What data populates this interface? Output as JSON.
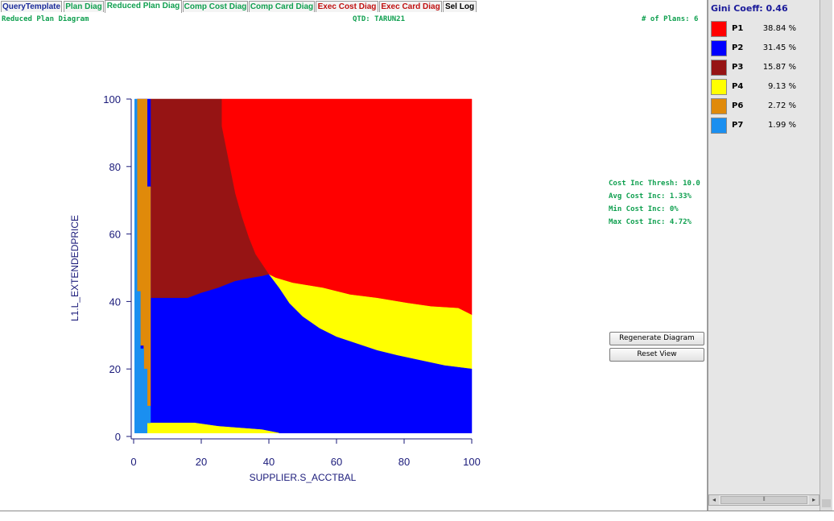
{
  "tabs": [
    {
      "label": "QueryTemplate",
      "color": "#1a2b9a",
      "active": false
    },
    {
      "label": "Plan Diag",
      "color": "#10a050",
      "active": false
    },
    {
      "label": "Reduced Plan Diag",
      "color": "#10a050",
      "active": true
    },
    {
      "label": "Comp Cost Diag",
      "color": "#10a050",
      "active": false
    },
    {
      "label": "Comp Card Diag",
      "color": "#10a050",
      "active": false
    },
    {
      "label": "Exec Cost Diag",
      "color": "#c01010",
      "active": false
    },
    {
      "label": "Exec Card Diag",
      "color": "#c01010",
      "active": false
    },
    {
      "label": "Sel Log",
      "color": "#000000",
      "active": false
    }
  ],
  "status": {
    "diagram_name": "Reduced Plan Diagram",
    "qtd": "QTD: TARUN21",
    "num_plans": "# of Plans: 6"
  },
  "stats": {
    "cost_inc_thresh": "Cost Inc Thresh: 10.0",
    "avg_cost_inc": "Avg Cost Inc: 1.33%",
    "min_cost_inc": "Min Cost Inc: 0%",
    "max_cost_inc": "Max Cost Inc: 4.72%"
  },
  "buttons": {
    "regenerate": "Regenerate Diagram",
    "reset": "Reset View"
  },
  "legend": {
    "gini": "Gini Coeff: 0.46",
    "items": [
      {
        "name": "P1",
        "percent": "38.84 %",
        "color": "#ff0000"
      },
      {
        "name": "P2",
        "percent": "31.45 %",
        "color": "#0000ff"
      },
      {
        "name": "P3",
        "percent": "15.87 %",
        "color": "#961414"
      },
      {
        "name": "P4",
        "percent": "9.13 %",
        "color": "#ffff00"
      },
      {
        "name": "P6",
        "percent": "2.72 %",
        "color": "#e08a0a"
      },
      {
        "name": "P7",
        "percent": "1.99 %",
        "color": "#1a8ff0"
      }
    ]
  },
  "plot": {
    "x_label": "SUPPLIER.S_ACCTBAL",
    "y_label": "L1.L_EXTENDEDPRICE",
    "x_range": [
      0,
      100
    ],
    "y_range": [
      0,
      100
    ],
    "x_ticks": [
      "0",
      "20",
      "40",
      "60",
      "80",
      "100"
    ],
    "y_ticks": [
      "0",
      "20",
      "40",
      "60",
      "80",
      "100"
    ],
    "regions": [
      {
        "plan": "P1",
        "color": "#ff0000",
        "points": [
          [
            26,
            100
          ],
          [
            100,
            100
          ],
          [
            100,
            36
          ],
          [
            96,
            38
          ],
          [
            88,
            38.5
          ],
          [
            81,
            39.5
          ],
          [
            72,
            41
          ],
          [
            64,
            42
          ],
          [
            56,
            44
          ],
          [
            47,
            45.5
          ],
          [
            42,
            47
          ],
          [
            40,
            48
          ],
          [
            38,
            51
          ],
          [
            36,
            54
          ],
          [
            34,
            59
          ],
          [
            32,
            65
          ],
          [
            30,
            72
          ],
          [
            28,
            82
          ],
          [
            26,
            92
          ]
        ]
      },
      {
        "plan": "P3",
        "color": "#961414",
        "points": [
          [
            5,
            100
          ],
          [
            26,
            100
          ],
          [
            26,
            92
          ],
          [
            28,
            82
          ],
          [
            30,
            72
          ],
          [
            32,
            65
          ],
          [
            34,
            59
          ],
          [
            36,
            54
          ],
          [
            38,
            51
          ],
          [
            40,
            48
          ],
          [
            38,
            47.5
          ],
          [
            35,
            47
          ],
          [
            30,
            46
          ],
          [
            25,
            44
          ],
          [
            20,
            42.5
          ],
          [
            16,
            41
          ],
          [
            5,
            41
          ]
        ]
      },
      {
        "plan": "P4",
        "color": "#ffff00",
        "points": [
          [
            40,
            48
          ],
          [
            42,
            47
          ],
          [
            47,
            45.5
          ],
          [
            56,
            44
          ],
          [
            64,
            42
          ],
          [
            72,
            41
          ],
          [
            81,
            39.5
          ],
          [
            88,
            38.5
          ],
          [
            96,
            38
          ],
          [
            100,
            36
          ],
          [
            100,
            20
          ],
          [
            92,
            21
          ],
          [
            85,
            22.5
          ],
          [
            78,
            24
          ],
          [
            72,
            25.5
          ],
          [
            66,
            27.5
          ],
          [
            60,
            29.5
          ],
          [
            55,
            32
          ],
          [
            50,
            35.5
          ],
          [
            46,
            39.5
          ],
          [
            43,
            44
          ]
        ]
      },
      {
        "plan": "P2",
        "color": "#0000ff",
        "points": [
          [
            5,
            41
          ],
          [
            16,
            41
          ],
          [
            20,
            42.5
          ],
          [
            25,
            44
          ],
          [
            30,
            46
          ],
          [
            35,
            47
          ],
          [
            38,
            47.5
          ],
          [
            40,
            48
          ],
          [
            43,
            44
          ],
          [
            46,
            39.5
          ],
          [
            50,
            35.5
          ],
          [
            55,
            32
          ],
          [
            60,
            29.5
          ],
          [
            66,
            27.5
          ],
          [
            72,
            25.5
          ],
          [
            78,
            24
          ],
          [
            85,
            22.5
          ],
          [
            92,
            21
          ],
          [
            100,
            20
          ],
          [
            100,
            1
          ],
          [
            43,
            1
          ],
          [
            38,
            2
          ],
          [
            25,
            3
          ],
          [
            18,
            4
          ],
          [
            5,
            4
          ],
          [
            5,
            9
          ],
          [
            2,
            9
          ],
          [
            2,
            43
          ],
          [
            1,
            43
          ],
          [
            1,
            100
          ],
          [
            5,
            100
          ]
        ]
      },
      {
        "plan": "P4",
        "color": "#ffff00",
        "points": [
          [
            4,
            1
          ],
          [
            4,
            4
          ],
          [
            18,
            4
          ],
          [
            25,
            3
          ],
          [
            38,
            2
          ],
          [
            43,
            1
          ]
        ]
      },
      {
        "plan": "P6",
        "color": "#e08a0a",
        "points": [
          [
            1,
            100
          ],
          [
            4,
            100
          ],
          [
            4,
            74
          ],
          [
            5,
            74
          ],
          [
            5,
            9
          ],
          [
            4,
            9
          ],
          [
            4,
            20
          ],
          [
            3,
            20
          ],
          [
            3,
            27
          ],
          [
            2,
            27
          ],
          [
            2,
            43
          ],
          [
            1,
            43
          ]
        ]
      },
      {
        "plan": "P7",
        "color": "#1a8ff0",
        "points": [
          [
            0.3,
            100
          ],
          [
            1,
            100
          ],
          [
            1,
            43
          ],
          [
            2,
            43
          ],
          [
            2,
            26
          ],
          [
            3,
            26
          ],
          [
            3,
            20
          ],
          [
            4,
            20
          ],
          [
            4,
            9
          ],
          [
            5,
            9
          ],
          [
            5,
            4
          ],
          [
            4,
            4
          ],
          [
            4,
            1
          ],
          [
            0.3,
            1
          ]
        ]
      }
    ]
  }
}
